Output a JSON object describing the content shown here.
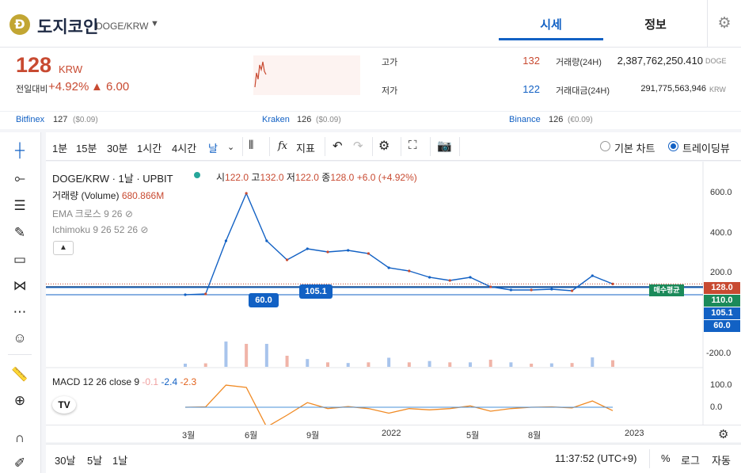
{
  "coin": {
    "name": "도지코인",
    "pair": "DOGE/KRW",
    "logo_letter": "Ɖ"
  },
  "tabs": [
    {
      "label": "시세",
      "active": true
    },
    {
      "label": "정보",
      "active": false
    }
  ],
  "ticker": {
    "price": "128",
    "unit": "KRW",
    "change_label": "전일대비",
    "change_rate": "+4.92%",
    "change_amount": "▲ 6.00",
    "high_label": "고가",
    "high": "132",
    "low_label": "저가",
    "low": "122",
    "volume_label": "거래량(24H)",
    "volume": "2,387,762,250.410",
    "volume_unit": "DOGE",
    "value_label": "거래대금(24H)",
    "value": "291,775,563,946",
    "value_unit": "KRW"
  },
  "exchanges": [
    {
      "name": "Bitfinex",
      "price": "127",
      "sub": "($0.09)"
    },
    {
      "name": "Kraken",
      "price": "126",
      "sub": "($0.09)"
    },
    {
      "name": "Binance",
      "price": "126",
      "sub": "(€0.09)"
    }
  ],
  "toolbar": {
    "intervals": [
      "1분",
      "15분",
      "30분",
      "1시간",
      "4시간",
      "날"
    ],
    "indicators_label": "지표",
    "chart_modes": [
      {
        "label": "기본 차트",
        "selected": false
      },
      {
        "label": "트레이딩뷰",
        "selected": true
      }
    ]
  },
  "legend": {
    "symbol": "DOGE/KRW · 1날 · UPBIT",
    "o_label": "시",
    "o": "122.0",
    "h_label": "고",
    "h": "132.0",
    "l_label": "저",
    "l": "122.0",
    "c_label": "종",
    "c": "128.0",
    "chg": "+6.0 (+4.92%)",
    "volume_name": "거래량 (Volume)",
    "volume_value": "680.866M",
    "ema": "EMA 크로스 9 26",
    "ichimoku": "Ichimoku 9 26 52 26",
    "macd_name": "MACD 12 26 close 9",
    "macd_values": [
      "-0.1",
      "-2.4",
      "-2.3"
    ]
  },
  "axis": {
    "y_ticks": [
      "600.0",
      "400.0",
      "200.0",
      "-200.0"
    ],
    "macd_ticks": [
      "100.0",
      "0.0"
    ],
    "x_ticks": [
      "3월",
      "6월",
      "9월",
      "2022",
      "5월",
      "8월",
      "2023"
    ]
  },
  "tags": {
    "current": "128.0",
    "avg_line": "110.0",
    "blue_line": "105.1",
    "lower_line": "60.0",
    "avg_label": "매수평균",
    "box_mid": "105.1",
    "box_left": "60.0"
  },
  "bottom": {
    "ranges": [
      "30날",
      "5날",
      "1날"
    ],
    "clock": "11:37:52 (UTC+9)",
    "percent": "%",
    "log": "로그",
    "auto": "자동"
  },
  "colors": {
    "up": "#c84a31",
    "down": "#1261c4",
    "accent": "#1261c4",
    "avg_green": "#1b8a5a",
    "macd_orange": "#f08a24"
  },
  "chart_data": {
    "type": "line",
    "x": [
      "2021-02",
      "2021-03",
      "2021-04",
      "2021-05",
      "2021-06",
      "2021-07",
      "2021-08",
      "2021-09",
      "2021-10",
      "2021-11",
      "2021-12",
      "2022-01",
      "2022-02",
      "2022-03",
      "2022-04",
      "2022-05",
      "2022-06",
      "2022-07",
      "2022-08",
      "2022-09",
      "2022-10",
      "2022-11"
    ],
    "series": [
      {
        "values": [
          60,
          65,
          400,
          700,
          400,
          280,
          350,
          330,
          340,
          320,
          230,
          210,
          170,
          150,
          170,
          110,
          90,
          90,
          95,
          85,
          180,
          128
        ]
      }
    ],
    "ylim": [
      -250,
      750
    ],
    "grid": false
  }
}
